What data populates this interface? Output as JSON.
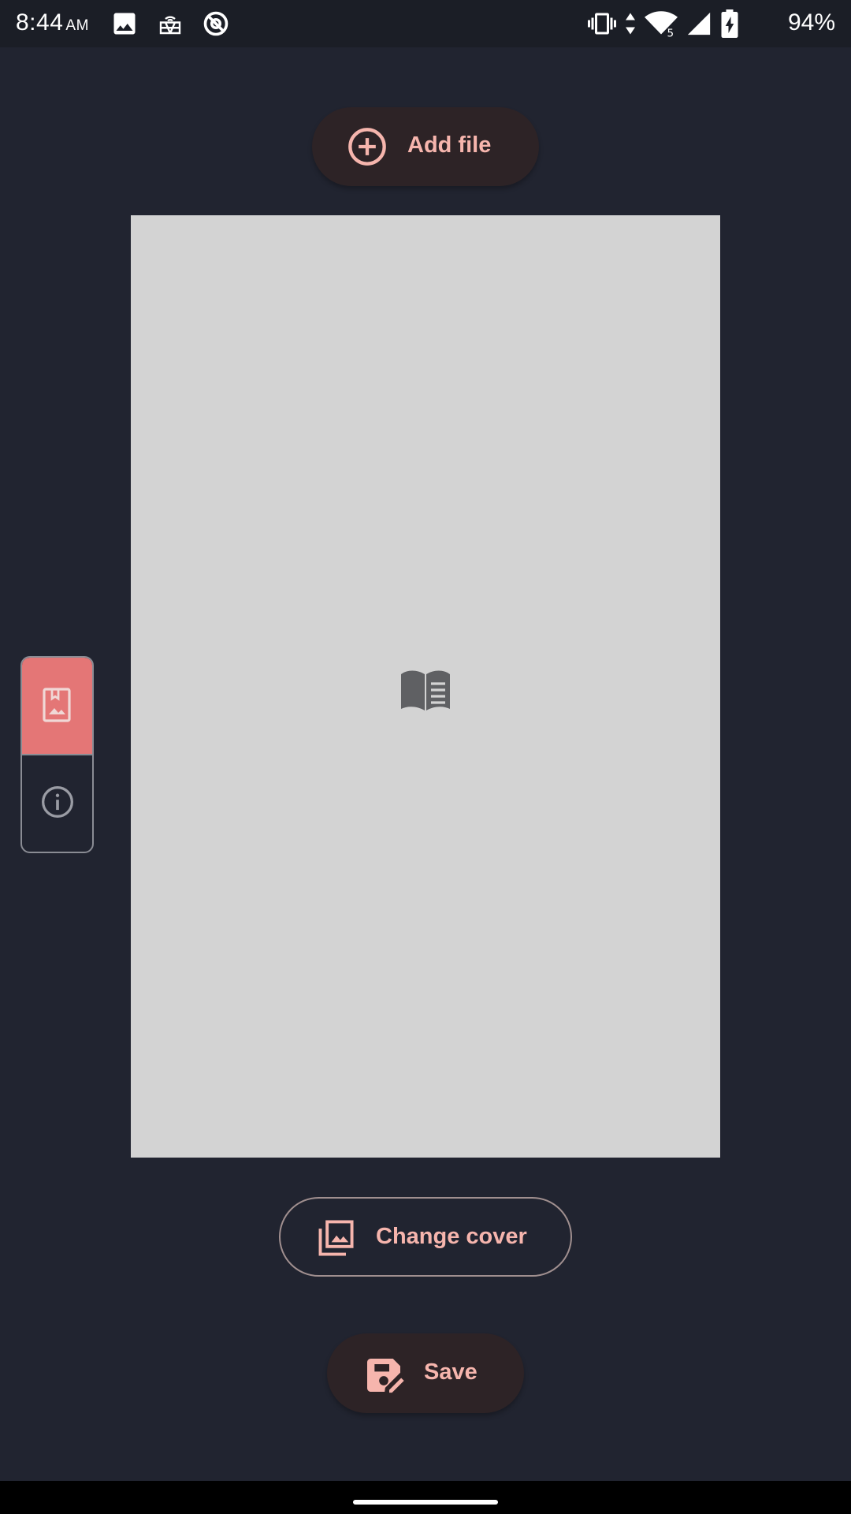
{
  "status_bar": {
    "time": "8:44",
    "ampm": "AM",
    "battery_percent": "94%",
    "left_icons": [
      "image-icon",
      "cast-icon",
      "no-disturb-icon"
    ],
    "right_icons": [
      "vibrate-icon",
      "data-arrows-icon",
      "wifi-icon",
      "signal-icon",
      "battery-charging-icon"
    ],
    "wifi_badge": "5"
  },
  "toolbar": {
    "add_file_label": "Add file",
    "change_cover_label": "Change cover",
    "save_label": "Save"
  },
  "side_tabs": [
    {
      "name": "cover",
      "icon": "cover-image-icon",
      "selected": true
    },
    {
      "name": "info",
      "icon": "info-icon",
      "selected": false
    }
  ],
  "cover": {
    "placeholder_icon": "book-open-icon"
  },
  "colors": {
    "background": "#212430",
    "accent": "#f6b5ad",
    "pill_bg": "#2d2326",
    "cover_bg": "#d3d3d3",
    "tab_selected": "#e47676"
  }
}
